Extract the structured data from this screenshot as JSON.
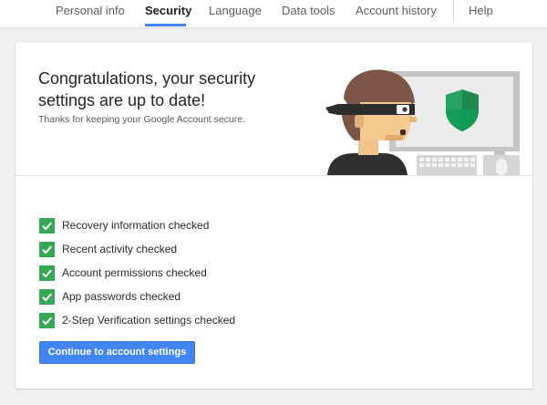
{
  "nav": {
    "tabs": [
      {
        "label": "Personal info"
      },
      {
        "label": "Security",
        "active": true
      },
      {
        "label": "Language"
      },
      {
        "label": "Data tools"
      },
      {
        "label": "Account history"
      }
    ],
    "help_label": "Help",
    "accent_color": "#4285f4"
  },
  "card": {
    "headline": "Congratulations, your security settings are up to date!",
    "subtext": "Thanks for keeping your Google Account secure.",
    "illustration": {
      "icons": [
        "masked-person-icon",
        "computer-monitor-icon",
        "shield-icon",
        "keyboard-icon",
        "mouse-icon"
      ]
    }
  },
  "checklist": {
    "check_color": "#34a853",
    "items": [
      {
        "label": "Recovery information checked"
      },
      {
        "label": "Recent activity checked"
      },
      {
        "label": "Account permissions checked"
      },
      {
        "label": "App passwords checked"
      },
      {
        "label": "2-Step Verification settings checked"
      }
    ]
  },
  "actions": {
    "continue_label": "Continue to account settings",
    "button_color": "#4285f4"
  }
}
